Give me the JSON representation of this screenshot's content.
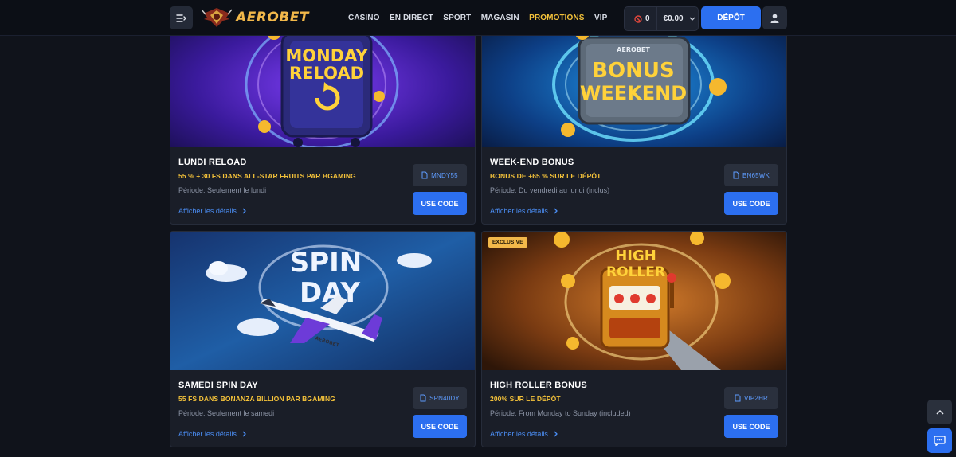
{
  "header": {
    "logo_text": "AEROBET",
    "nav": [
      {
        "label": "CASINO",
        "active": false
      },
      {
        "label": "EN DIRECT",
        "active": false
      },
      {
        "label": "SPORT",
        "active": false
      },
      {
        "label": "MAGASIN",
        "active": false
      },
      {
        "label": "PROMOTIONS",
        "active": true
      },
      {
        "label": "VIP",
        "active": false
      }
    ],
    "bonus_count": "0",
    "balance": "€0.00",
    "deposit_label": "DÉPÔT"
  },
  "promos": [
    {
      "banner_text": [
        "MONDAY",
        "RELOAD"
      ],
      "title": "LUNDI RELOAD",
      "subtitle": "55 % + 30 FS DANS ALL-STAR FRUITS PAR BGAMING",
      "period": "Période: Seulement le lundi",
      "details": "Afficher les détails",
      "code": "MNDY55",
      "button": "USE CODE"
    },
    {
      "banner_text": [
        "AEROBET",
        "BONUS",
        "WEEKEND"
      ],
      "title": "WEEK-END BONUS",
      "subtitle": "BONUS DE +65 % SUR LE DÉPÔT",
      "period": "Période: Du vendredi au lundi (inclus)",
      "details": "Afficher les détails",
      "code": "BN65WK",
      "button": "USE CODE"
    },
    {
      "banner_text": [
        "SPIN",
        "DAY",
        "AEROBET"
      ],
      "title": "SAMEDI SPIN DAY",
      "subtitle": "55 FS DANS BONANZA BILLION PAR BGAMING",
      "period": "Période: Seulement le samedi",
      "details": "Afficher les détails",
      "code": "SPN40DY",
      "button": "USE CODE"
    },
    {
      "badge": "EXCLUSIVE",
      "banner_text": [
        "HIGH",
        "ROLLER"
      ],
      "title": "HIGH ROLLER BONUS",
      "subtitle": "200% SUR LE DÉPÔT",
      "period": "Période: From Monday to Sunday (included)",
      "details": "Afficher les détails",
      "code": "VIP2HR",
      "button": "USE CODE"
    }
  ],
  "colors": {
    "accent_blue": "#2c6ff0",
    "promo_yellow": "#f4c23a",
    "background": "#10131b",
    "card": "#1a1e28"
  }
}
